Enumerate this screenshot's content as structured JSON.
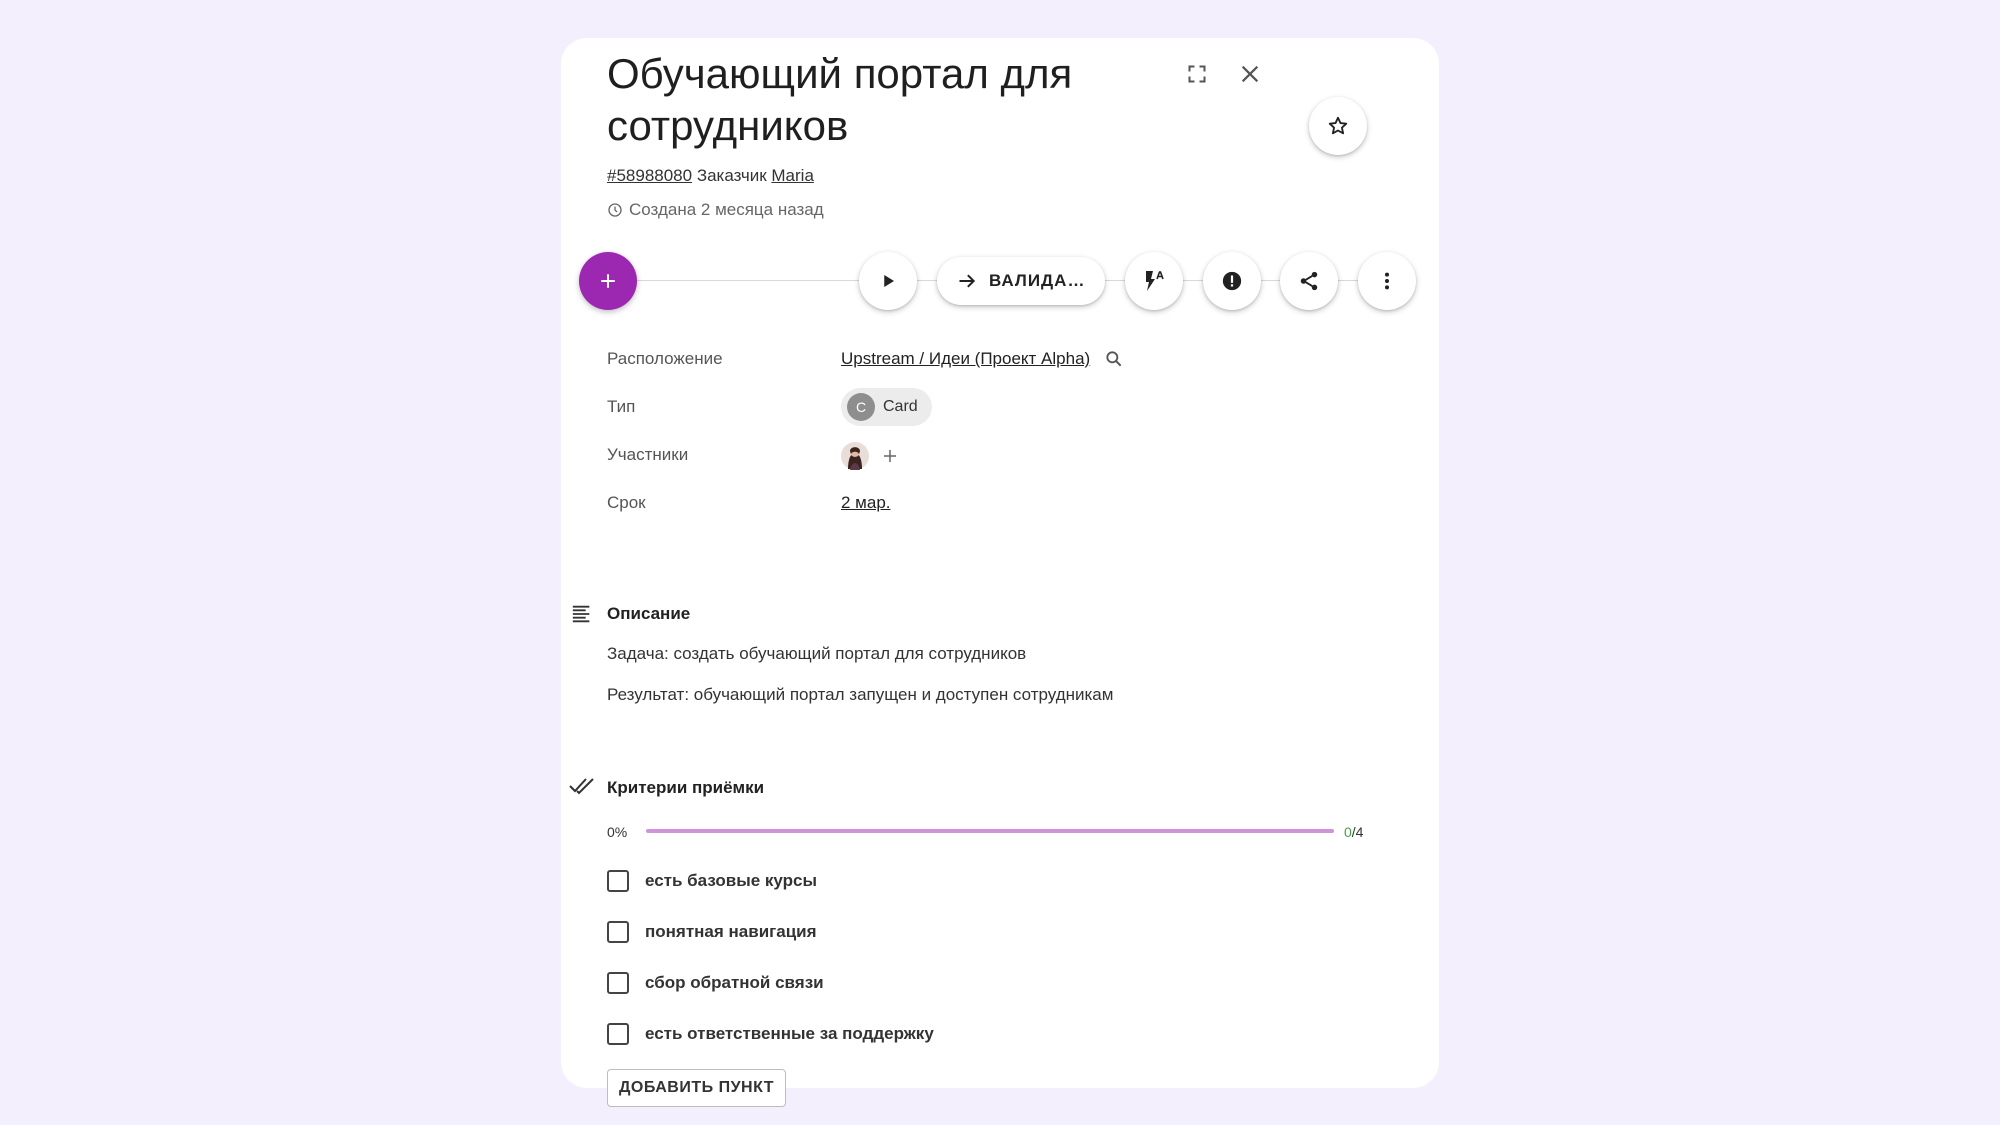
{
  "card": {
    "title": "Обучающий портал для сотрудников",
    "id_link": "#58988080",
    "customer_label": "Заказчик",
    "customer_name": "Maria",
    "created_text": "Создана 2 месяца назад"
  },
  "toolbar": {
    "status_label": "ВАЛИДА…"
  },
  "properties": {
    "location_label": "Расположение",
    "location_value": "Upstream / Идеи (Проект Alpha)",
    "type_label": "Тип",
    "type_avatar_letter": "C",
    "type_value": "Card",
    "members_label": "Участники",
    "due_label": "Срок",
    "due_value": "2 мар."
  },
  "description": {
    "heading": "Описание",
    "lines": [
      "Задача: создать обучающий портал для сотрудников",
      "Результат: обучающий портал запущен и доступен сотрудникам"
    ]
  },
  "checklist": {
    "heading": "Критерии приёмки",
    "percent_text": "0%",
    "progress": 0,
    "done_count": "0",
    "total_text": "/4",
    "items": [
      "есть базовые курсы",
      "понятная навигация",
      "сбор обратной связи",
      "есть ответственные за поддержку"
    ],
    "add_button_label": "ДОБАВИТЬ ПУНКТ"
  },
  "colors": {
    "accent": "#9c27b0",
    "progress_track": "#ce93d8",
    "done_count": "#43a047",
    "background": "#f3effc"
  },
  "icons": {
    "fullscreen": "fullscreen-icon",
    "close": "close-icon",
    "star": "star-outline-icon",
    "add": "plus-icon",
    "play": "play-icon",
    "arrow": "arrow-right-icon",
    "automation": "flash-auto-icon",
    "alert": "alert-circle-icon",
    "share": "share-icon",
    "more": "more-vertical-icon",
    "search": "search-icon",
    "description": "text-lines-icon",
    "checklist": "double-check-icon",
    "clock": "clock-icon"
  }
}
